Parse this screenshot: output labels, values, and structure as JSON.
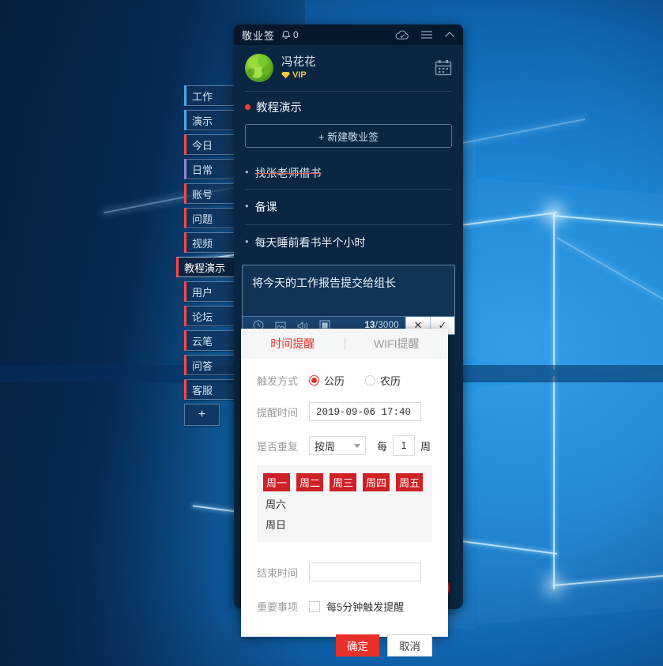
{
  "desktop": {
    "wallpaper": "windows-10-hero",
    "accent": "#1b86d6"
  },
  "categories": {
    "items": [
      {
        "label": "工作",
        "accent": "#4aa8e8",
        "active": false
      },
      {
        "label": "演示",
        "accent": "#4aa8e8",
        "active": false
      },
      {
        "label": "今日",
        "accent": "#ff4646",
        "active": false
      },
      {
        "label": "日常",
        "accent": "#8f86d8",
        "active": false
      },
      {
        "label": "账号",
        "accent": "#ff4646",
        "active": false
      },
      {
        "label": "问题",
        "accent": "#ff4646",
        "active": false
      },
      {
        "label": "视频",
        "accent": "#ff4646",
        "active": false
      },
      {
        "label": "教程演示",
        "accent": "#ff4646",
        "active": true
      },
      {
        "label": "用户",
        "accent": "#ff4646",
        "active": false
      },
      {
        "label": "论坛",
        "accent": "#ff4646",
        "active": false
      },
      {
        "label": "云笔",
        "accent": "#ff4646",
        "active": false
      },
      {
        "label": "问答",
        "accent": "#ff4646",
        "active": false
      },
      {
        "label": "客服",
        "accent": "#ff4646",
        "active": false
      }
    ],
    "add_label": "+"
  },
  "app": {
    "titlebar": {
      "title": "敬业签",
      "notification_count": "0",
      "bell_icon": "bell-icon",
      "cloud_icon": "cloud-sync-icon",
      "menu_icon": "hamburger-menu-icon",
      "collapse_icon": "chevron-up-icon"
    },
    "profile": {
      "name": "冯花花",
      "badge": "VIP",
      "badge_icon": "diamond-icon",
      "avatar_icon": "avatar",
      "calendar_icon": "calendar-icon"
    },
    "group": {
      "title": "教程演示",
      "dot_color": "#ff3b30",
      "new_note_label": "+ 新建敬业签"
    },
    "notes": [
      {
        "text": "找张老师借书",
        "done": true
      },
      {
        "text": "备课",
        "done": false
      },
      {
        "text": "每天睡前看书半个小时",
        "done": false
      }
    ],
    "editor": {
      "value": "将今天的工作报告提交给组长",
      "count": "13",
      "count_max": "/3000",
      "icons": [
        "clock-icon",
        "image-icon",
        "sound-icon",
        "stop-icon"
      ],
      "cancel_label": "✕",
      "confirm_label": "✓"
    },
    "record_button": {
      "label": "",
      "color": "#e02b2b",
      "icon": "record-icon"
    }
  },
  "dialog": {
    "tabs": [
      {
        "label": "时间提醒",
        "selected": true
      },
      {
        "label": "WIFI提醒",
        "selected": false
      }
    ],
    "trigger": {
      "label": "触发方式",
      "options": [
        {
          "label": "公历",
          "selected": true
        },
        {
          "label": "农历",
          "selected": false
        }
      ]
    },
    "remind_time": {
      "label": "提醒时间",
      "value": "2019-09-06 17:40"
    },
    "repeat": {
      "label": "是否重复",
      "mode": "按周",
      "every_label": "每",
      "interval": "1",
      "unit_label": "周",
      "weekdays": [
        {
          "label": "周一",
          "selected": true
        },
        {
          "label": "周二",
          "selected": true
        },
        {
          "label": "周三",
          "selected": true
        },
        {
          "label": "周四",
          "selected": true
        },
        {
          "label": "周五",
          "selected": true
        },
        {
          "label": "周六",
          "selected": false
        },
        {
          "label": "周日",
          "selected": false
        }
      ]
    },
    "end_time": {
      "label": "结束时间",
      "value": ""
    },
    "important": {
      "label": "重要事项",
      "checkbox_label": "每5分钟触发提醒",
      "checked": false
    },
    "actions": {
      "confirm": "确定",
      "cancel": "取消"
    }
  }
}
